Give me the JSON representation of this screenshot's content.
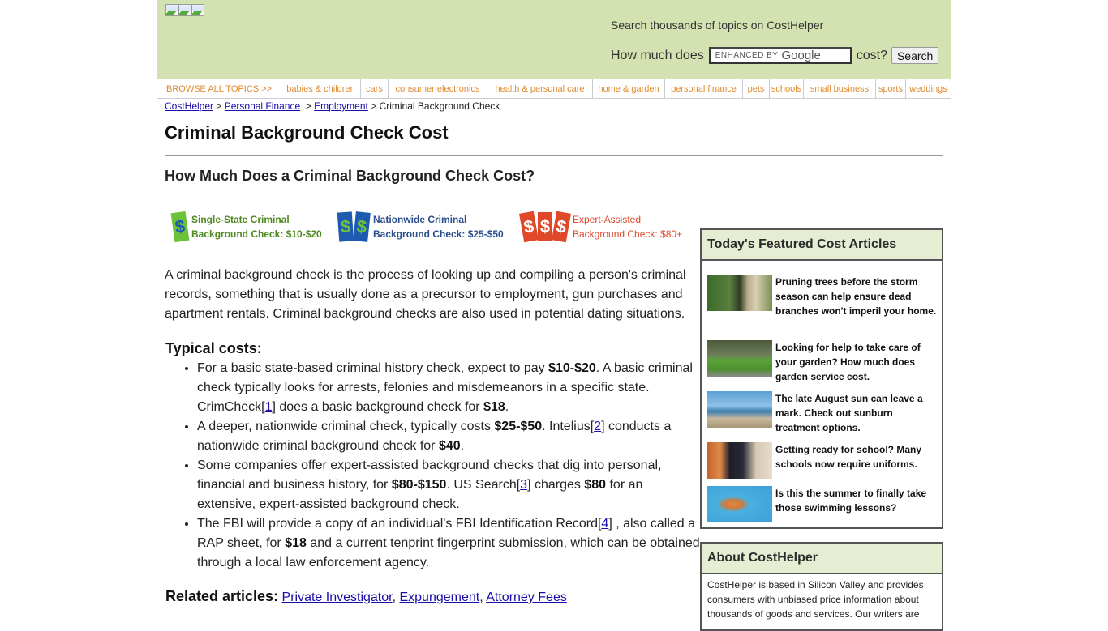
{
  "header": {
    "logo_images": [
      "broken-image",
      "broken-image",
      "broken-image"
    ],
    "search_note": "Search thousands of topics on CostHelper",
    "search_prefix": "How much does",
    "search_placeholder_brand": "ENHANCED BY",
    "search_placeholder_google": "Google",
    "search_suffix": "cost?",
    "search_button": "Search"
  },
  "nav": {
    "items": [
      {
        "label": "BROWSE ALL TOPICS >>"
      },
      {
        "label": "babies & children"
      },
      {
        "label": "cars"
      },
      {
        "label": "consumer electronics"
      },
      {
        "label": "health & personal care"
      },
      {
        "label": "home & garden"
      },
      {
        "label": "personal finance"
      },
      {
        "label": "pets"
      },
      {
        "label": "schools"
      },
      {
        "label": "small business"
      },
      {
        "label": "sports"
      },
      {
        "label": "weddings"
      }
    ],
    "color": "#e08a2e"
  },
  "breadcrumb": {
    "items": [
      "CostHelper",
      "Personal Finance",
      "Employment"
    ],
    "separator": ">",
    "current": "Criminal Background Check"
  },
  "article": {
    "title": "Criminal Background Check Cost",
    "subtitle": "How Much Does a Criminal Background Check Cost?",
    "tiers": [
      {
        "line1": "Single-State Criminal",
        "line2": "Background Check: $10-$20",
        "icon": "dollar-bill-single-icon",
        "color": "#4e8a1f",
        "bill_color": "#6cc03a"
      },
      {
        "line1": "Nationwide Criminal",
        "line2": "Background Check: $25-$50",
        "icon": "dollar-bill-double-icon",
        "color": "#2b4f8e",
        "bill_color": "#1e5ab0"
      },
      {
        "line1": "Expert-Assisted",
        "line2": "Background Check: $80+",
        "icon": "dollar-bill-triple-icon",
        "color": "#e0482a",
        "bill_color": "#e0482a"
      }
    ],
    "intro": "A criminal background check is the process of looking up and compiling a person's criminal records, something that is usually done as a precursor to employment, gun purchases and apartment rentals. Criminal background checks are also used in potential dating situations.",
    "typical_heading": "Typical costs:",
    "costs": [
      {
        "t1": "For a basic state-based criminal history check, expect to pay ",
        "b1": "$10-$20",
        "t2": ". A basic criminal check typically looks for arrests, felonies and misdemeanors in a specific state. CrimCheck[",
        "ref": "1",
        "t3": "] does a basic background check for ",
        "b2": "$18",
        "t4": "."
      },
      {
        "t1": "A deeper, nationwide criminal check, typically costs ",
        "b1": "$25-$50",
        "t2": ". Intelius[",
        "ref": "2",
        "t3": "] conducts a nationwide criminal background check for ",
        "b2": "$40",
        "t4": "."
      },
      {
        "t1": "Some companies offer expert-assisted background checks that dig into personal, financial and business history, for ",
        "b1": "$80-$150",
        "t2": ". US Search[",
        "ref": "3",
        "t3": "] charges ",
        "b2": "$80",
        "t4": " for an extensive, expert-assisted background check."
      },
      {
        "t1": "The FBI will provide a copy of an individual's FBI Identification Record[",
        "ref": "4",
        "t2": "] , also called a RAP sheet, for ",
        "b1": "$18",
        "t3": " and a current tenprint fingerprint submission, which can be obtained through a local law enforcement agency."
      }
    ],
    "related_label": "Related articles:",
    "related": [
      "Private Investigator",
      "Expungement",
      "Attorney Fees"
    ]
  },
  "sidebar": {
    "featured_title": "Today's Featured Cost Articles",
    "featured": [
      {
        "text": "Pruning trees before the storm season can help ensure dead branches won't imperil your home.",
        "image": "tree-pruning-photo"
      },
      {
        "text": "Looking for help to take care of your garden? How much does garden service cost.",
        "image": "gardener-photo"
      },
      {
        "text": "The late August sun can leave a mark. Check out sunburn treatment options.",
        "image": "sunburn-beach-photo"
      },
      {
        "text": "Getting ready for school? Many schools now require uniforms.",
        "image": "school-uniform-photo"
      },
      {
        "text": "Is this the summer to finally take those swimming lessons?",
        "image": "swimming-lesson-photo"
      }
    ],
    "about_title": "About CostHelper",
    "about_text": "CostHelper is based in Silicon Valley and provides consumers with unbiased price information about thousands of goods and services. Our writers are"
  }
}
